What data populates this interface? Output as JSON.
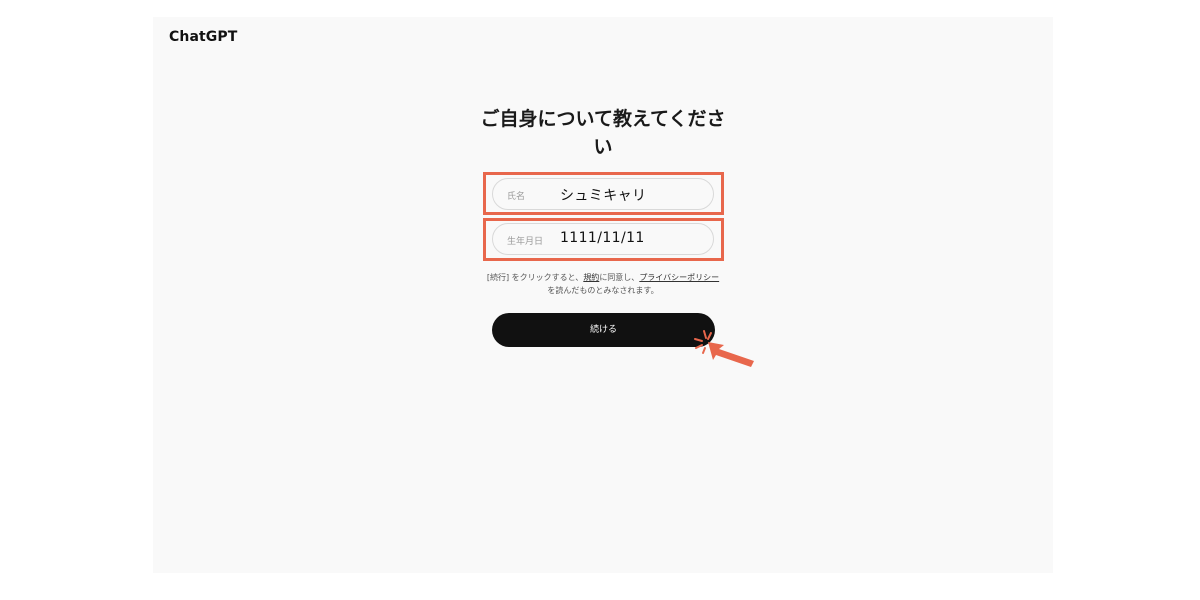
{
  "app": {
    "brand": "ChatGPT"
  },
  "form": {
    "heading": "ご自身について教えてください",
    "name_field": {
      "label": "氏名",
      "value": "シュミキャリ"
    },
    "birthday_field": {
      "label": "生年月日",
      "value": "1111/11/11"
    },
    "terms": {
      "prefix": "[続行] をクリックすると、",
      "terms_link": "規約",
      "middle": "に同意し、",
      "privacy_link": "プライバシーポリシー",
      "suffix": "を読んだものとみなされます。"
    },
    "continue_label": "続ける"
  },
  "colors": {
    "highlight": "#e8674c",
    "button_bg": "#111111",
    "screen_bg": "#f9f9f9"
  },
  "icons": {
    "cursor": "click-pointer-icon"
  }
}
